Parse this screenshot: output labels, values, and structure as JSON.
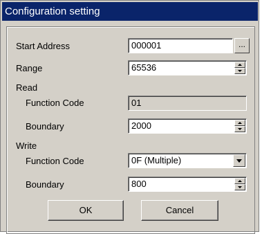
{
  "window": {
    "title": "Configuration setting"
  },
  "start_address": {
    "label": "Start Address",
    "value": "000001",
    "browse_label": "..."
  },
  "range": {
    "label": "Range",
    "value": "65536"
  },
  "read": {
    "group_label": "Read",
    "function_code_label": "Function Code",
    "function_code_value": "01",
    "boundary_label": "Boundary",
    "boundary_value": "2000"
  },
  "write": {
    "group_label": "Write",
    "function_code_label": "Function Code",
    "function_code_value": "0F (Multiple)",
    "boundary_label": "Boundary",
    "boundary_value": "800"
  },
  "buttons": {
    "ok": "OK",
    "cancel": "Cancel"
  }
}
